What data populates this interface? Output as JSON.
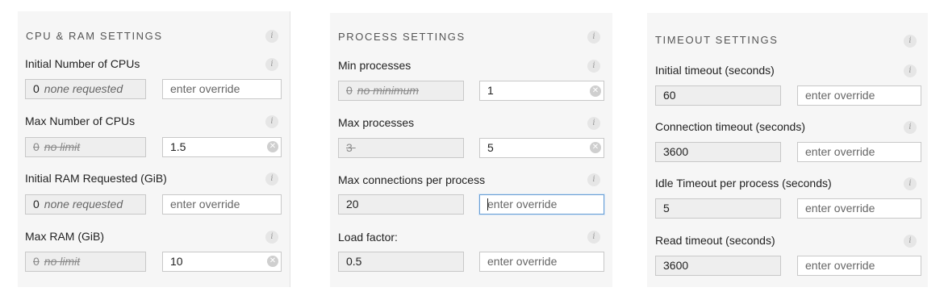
{
  "info_glyph": "i",
  "clear_glyph": "✕",
  "override_placeholder": "enter override",
  "cpu_ram": {
    "title": "CPU & RAM SETTINGS",
    "fields": [
      {
        "label": "Initial Number of CPUs",
        "default_value": "0",
        "default_note": "none requested",
        "override_value": ""
      },
      {
        "label": "Max Number of CPUs",
        "default_value": "0",
        "default_note": "no limit",
        "override_value": "1.5"
      },
      {
        "label": "Initial RAM Requested (GiB)",
        "default_value": "0",
        "default_note": "none requested",
        "override_value": ""
      },
      {
        "label": "Max RAM (GiB)",
        "default_value": "0",
        "default_note": "no limit",
        "override_value": "10"
      }
    ]
  },
  "process": {
    "title": "PROCESS SETTINGS",
    "fields": [
      {
        "label": "Min processes",
        "default_value": "0",
        "default_note": "no minimum",
        "override_value": "1"
      },
      {
        "label": "Max processes",
        "default_value": "3",
        "default_note": "",
        "override_value": "5"
      },
      {
        "label": "Max connections per process",
        "default_value": "20",
        "default_note": "",
        "override_value": ""
      },
      {
        "label": "Load factor:",
        "default_value": "0.5",
        "default_note": "",
        "override_value": ""
      }
    ]
  },
  "timeout": {
    "title": "TIMEOUT SETTINGS",
    "fields": [
      {
        "label": "Initial timeout (seconds)",
        "default_value": "60",
        "override_value": ""
      },
      {
        "label": "Connection timeout (seconds)",
        "default_value": "3600",
        "override_value": ""
      },
      {
        "label": "Idle Timeout per process (seconds)",
        "default_value": "5",
        "override_value": ""
      },
      {
        "label": "Read timeout (seconds)",
        "default_value": "3600",
        "override_value": ""
      }
    ]
  }
}
